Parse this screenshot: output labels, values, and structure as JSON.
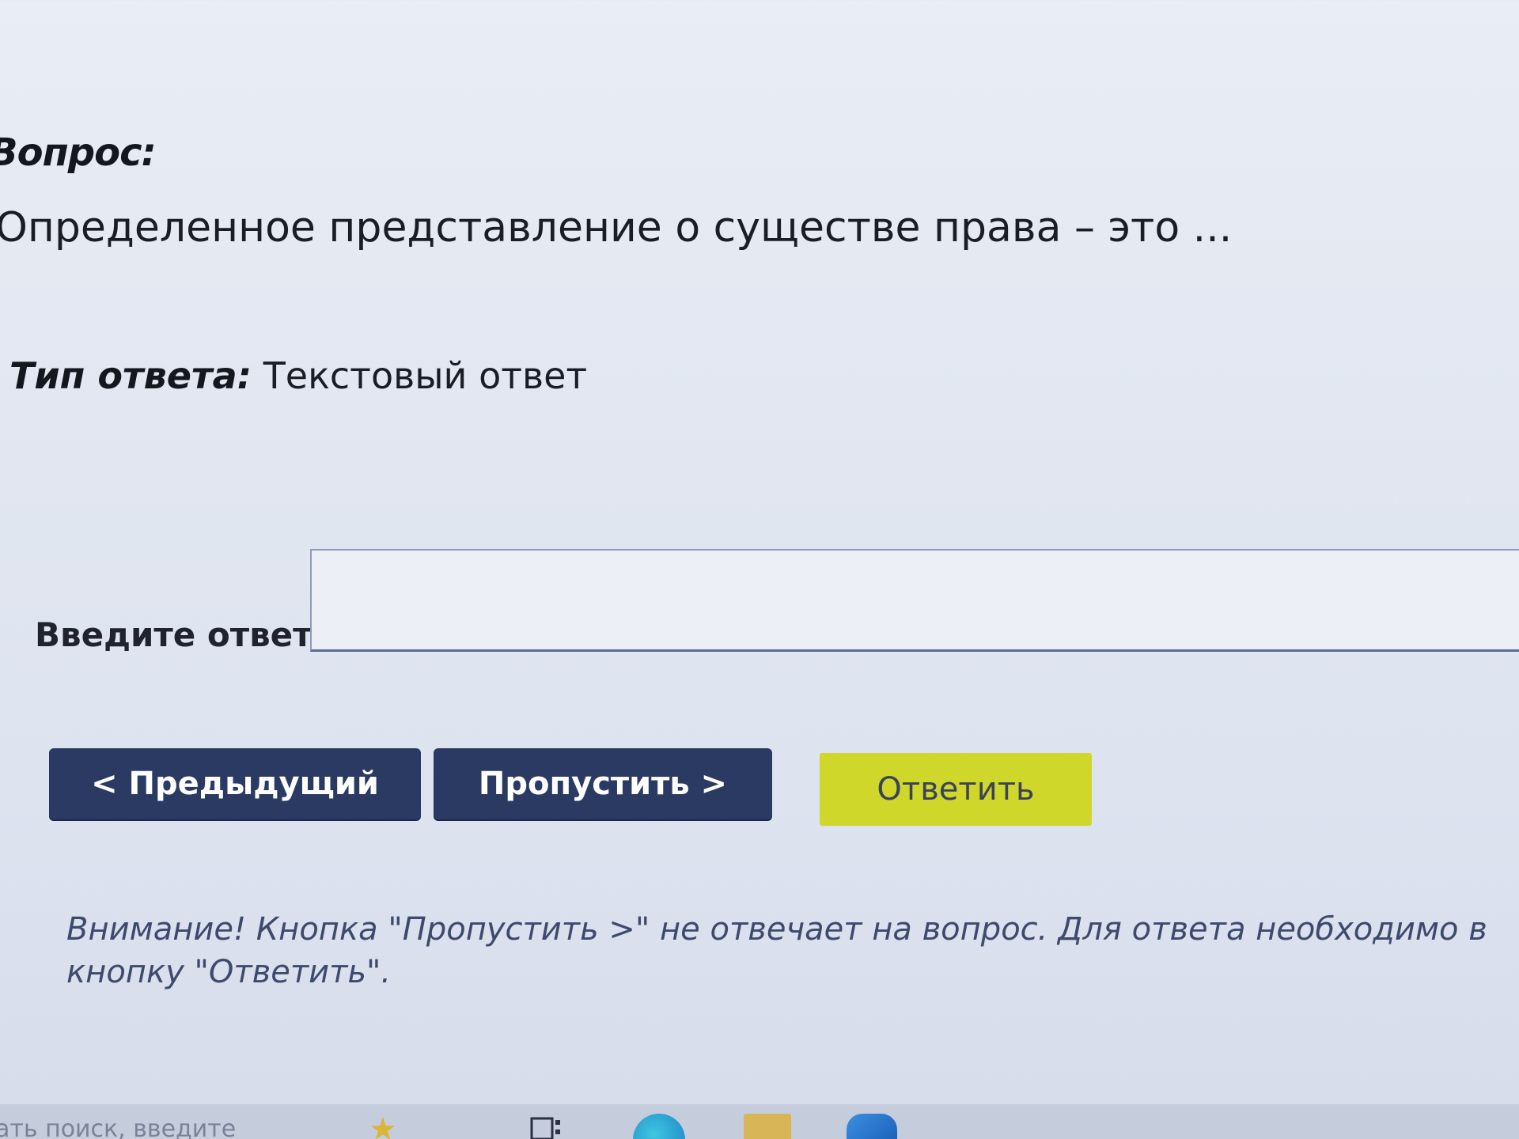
{
  "question": {
    "label": "Вопрос:",
    "text": "Определенное представление о существе права – это ..."
  },
  "answer_type": {
    "label": "Тип ответа:",
    "value": "Текстовый ответ"
  },
  "answer_field": {
    "label": "Введите ответ:",
    "value": ""
  },
  "buttons": {
    "previous": "< Предыдущий",
    "skip": "Пропустить >",
    "answer": "Ответить"
  },
  "warning": {
    "line1": "Внимание! Кнопка \"Пропустить >\" не отвечает на вопрос. Для ответа необходимо в",
    "line2": "кнопку \"Ответить\"."
  },
  "taskbar": {
    "search_placeholder": "ать поиск, введите",
    "icons": [
      "widgets-icon",
      "task-view-icon",
      "edge-icon",
      "file-explorer-icon",
      "store-icon"
    ]
  },
  "colors": {
    "dark_button": "#2a3a62",
    "answer_button": "#cfd72a",
    "warning_text": "#3e4a6c"
  }
}
